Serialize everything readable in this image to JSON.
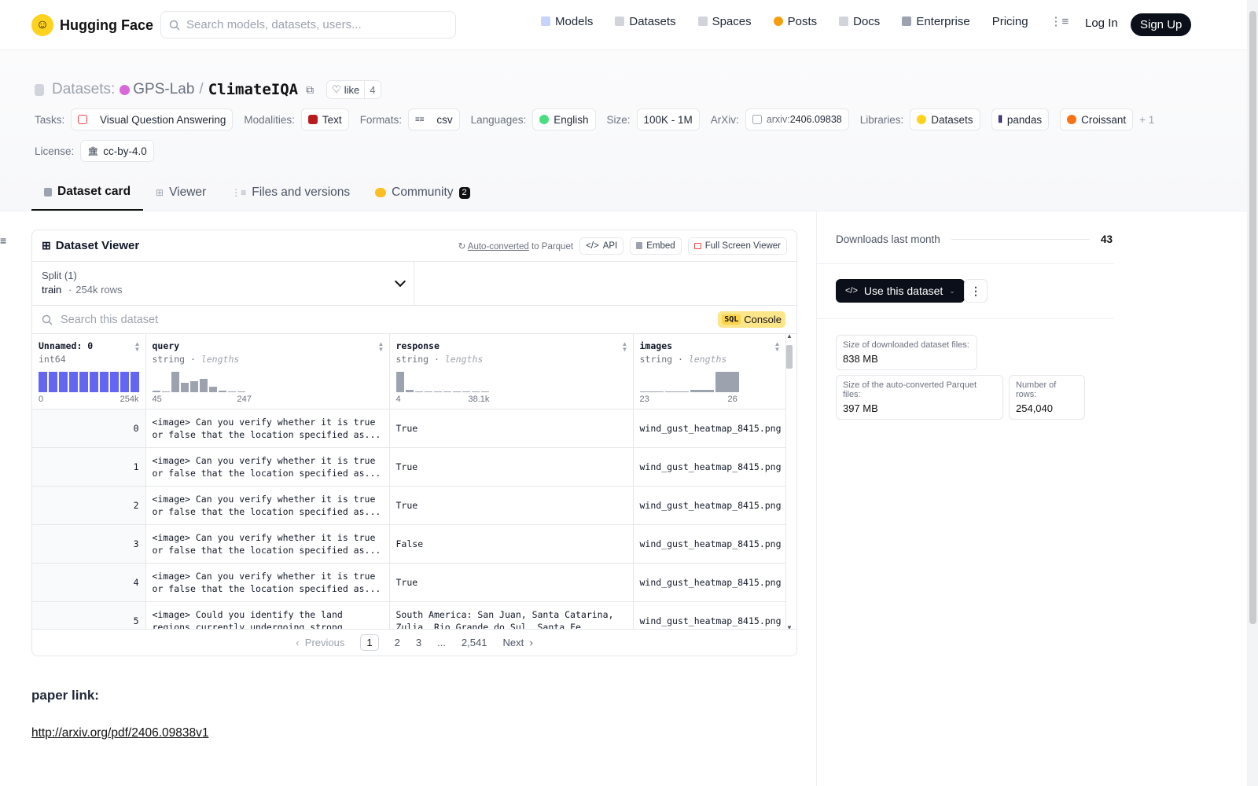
{
  "nav": {
    "logo": "Hugging Face",
    "search_placeholder": "Search models, datasets, users...",
    "links": [
      "Models",
      "Datasets",
      "Spaces",
      "Posts",
      "Docs",
      "Enterprise",
      "Pricing"
    ],
    "login": "Log In",
    "signup": "Sign Up"
  },
  "header": {
    "prefix": "Datasets:",
    "org": "GPS-Lab",
    "separator": "/",
    "name": "ClimateIQA",
    "like_label": "like",
    "like_count": "4"
  },
  "tags": {
    "tasks_label": "Tasks:",
    "task": "Visual Question Answering",
    "modalities_label": "Modalities:",
    "modality": "Text",
    "formats_label": "Formats:",
    "format": "csv",
    "languages_label": "Languages:",
    "language": "English",
    "size_label": "Size:",
    "size": "100K - 1M",
    "arxiv_label": "ArXiv:",
    "arxiv_prefix": "arxiv:",
    "arxiv_id": "2406.09838",
    "libraries_label": "Libraries:",
    "libraries": [
      "Datasets",
      "pandas",
      "Croissant"
    ],
    "libraries_more": "+ 1",
    "license_label": "License:",
    "license": "cc-by-4.0"
  },
  "tabs": [
    {
      "label": "Dataset card"
    },
    {
      "label": "Viewer"
    },
    {
      "label": "Files and versions"
    },
    {
      "label": "Community",
      "badge": "2"
    }
  ],
  "viewer": {
    "title": "Dataset Viewer",
    "auto_link": "Auto-converted",
    "auto_rest": "to Parquet",
    "api": "API",
    "embed": "Embed",
    "fullscreen": "Full Screen Viewer",
    "split_label": "Split (1)",
    "split_value": "train",
    "split_dot": "·",
    "split_rows": "254k rows",
    "search_placeholder": "Search this dataset",
    "sql_key": "SQL",
    "sql_label": "Console",
    "columns": [
      {
        "name": "Unnamed: 0",
        "type": "int64",
        "lengths": "",
        "min": "0",
        "max": "254k",
        "hist": [
          1,
          1,
          1,
          1,
          1,
          1,
          1,
          1,
          1,
          1
        ],
        "hist_color": "#6366f1"
      },
      {
        "name": "query",
        "type": "string",
        "lengths": "lengths",
        "min": "45",
        "max": "247",
        "hist": [
          0.08,
          0.04,
          1,
          0.45,
          0.55,
          0.65,
          0.28,
          0.06,
          0.04,
          0.04
        ],
        "hist_color": "#9ca3af"
      },
      {
        "name": "response",
        "type": "string",
        "lengths": "lengths",
        "min": "4",
        "max": "38.1k",
        "hist": [
          1,
          0.12,
          0.04,
          0.04,
          0.04,
          0.04,
          0.04,
          0.04,
          0.04,
          0.04
        ],
        "hist_color": "#9ca3af"
      },
      {
        "name": "images",
        "type": "string",
        "lengths": "lengths",
        "min": "23",
        "max": "26",
        "hist": [
          0.04,
          0.04,
          0.12,
          1
        ],
        "hist_color": "#9ca3af"
      }
    ],
    "rows": [
      {
        "idx": "0",
        "query": "<image> Can you verify whether it is true or false that the location specified as...",
        "response": "True",
        "image": "wind_gust_heatmap_8415.png"
      },
      {
        "idx": "1",
        "query": "<image> Can you verify whether it is true or false that the location specified as...",
        "response": "True",
        "image": "wind_gust_heatmap_8415.png"
      },
      {
        "idx": "2",
        "query": "<image> Can you verify whether it is true or false that the location specified as...",
        "response": "True",
        "image": "wind_gust_heatmap_8415.png"
      },
      {
        "idx": "3",
        "query": "<image> Can you verify whether it is true or false that the location specified as...",
        "response": "False",
        "image": "wind_gust_heatmap_8415.png"
      },
      {
        "idx": "4",
        "query": "<image> Can you verify whether it is true or false that the location specified as...",
        "response": "True",
        "image": "wind_gust_heatmap_8415.png"
      },
      {
        "idx": "5",
        "query": "<image> Could you identify the land regions currently undergoing strong gales...",
        "response": "South America: San Juan, Santa Catarina, Zulia, Rio Grande do Sul, Santa Fe Wester...",
        "image": "wind_gust_heatmap_8415.png"
      }
    ],
    "pager": {
      "prev": "Previous",
      "pages": [
        "1",
        "2",
        "3",
        "...",
        "2,541"
      ],
      "next": "Next"
    }
  },
  "card": {
    "paper_label": "paper link:",
    "paper_url": "http://arxiv.org/pdf/2406.09838v1"
  },
  "sidebar": {
    "downloads_label": "Downloads last month",
    "downloads": "43",
    "use_button": "Use this dataset",
    "stats": [
      {
        "key": "Size of downloaded dataset files:",
        "value": "838 MB"
      },
      {
        "key": "Size of the auto-converted Parquet files:",
        "value": "397 MB"
      },
      {
        "key": "Number of rows:",
        "value": "254,040"
      }
    ]
  }
}
